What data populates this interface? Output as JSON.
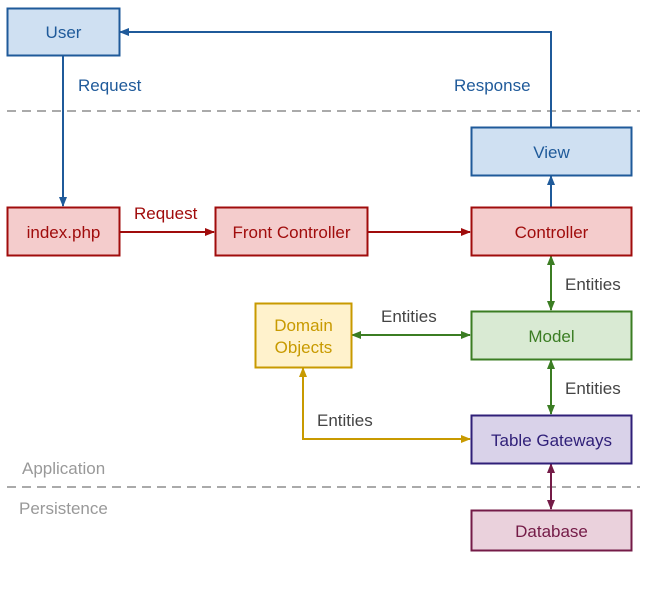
{
  "nodes": {
    "user": "User",
    "view": "View",
    "index": "index.php",
    "front_controller": "Front Controller",
    "controller": "Controller",
    "domain_objects_line1": "Domain",
    "domain_objects_line2": "Objects",
    "model": "Model",
    "table_gateways": "Table Gateways",
    "database": "Database"
  },
  "edges": {
    "user_request": "Request",
    "response": "Response",
    "index_request": "Request",
    "controller_model": "Entities",
    "domain_model": "Entities",
    "model_gateways": "Entities",
    "domain_gateways": "Entities"
  },
  "layers": {
    "application": "Application",
    "persistence": "Persistence"
  },
  "colors": {
    "blue": "#1f5a9a",
    "blue_fill": "#cfe0f2",
    "red": "#a00c0c",
    "red_fill": "#f4cccc",
    "green": "#3b7d23",
    "green_fill": "#d9ead3",
    "yellow": "#c89a00",
    "yellow_fill": "#fff2cc",
    "purple": "#2f1f78",
    "purple_fill": "#d9d2e9",
    "maroon": "#741b47",
    "maroon_fill": "#ead1dc",
    "gray": "#999999",
    "label": "#444444"
  }
}
